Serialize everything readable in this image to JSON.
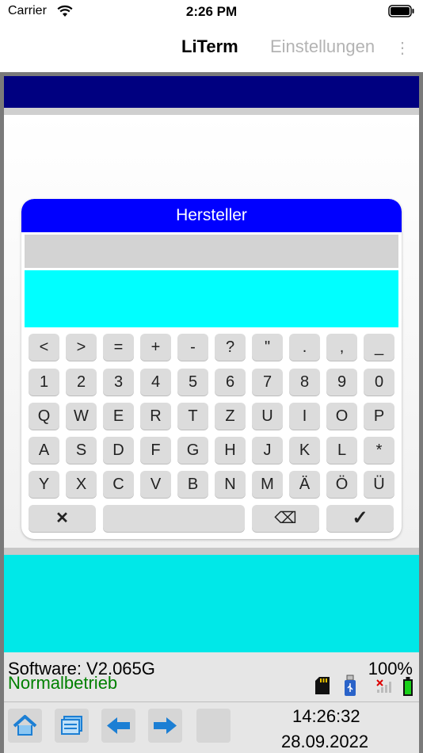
{
  "status_bar": {
    "carrier": "Carrier",
    "time": "2:26 PM"
  },
  "nav": {
    "title": "LiTerm",
    "settings": "Einstellungen",
    "more": "⋮"
  },
  "dialog": {
    "title": "Hersteller",
    "keys_row1": [
      "<",
      ">",
      "=",
      "+",
      "-",
      "?",
      "\"",
      ".",
      ",",
      "_"
    ],
    "keys_row2": [
      "1",
      "2",
      "3",
      "4",
      "5",
      "6",
      "7",
      "8",
      "9",
      "0"
    ],
    "keys_row3": [
      "Q",
      "W",
      "E",
      "R",
      "T",
      "Z",
      "U",
      "I",
      "O",
      "P"
    ],
    "keys_row4": [
      "A",
      "S",
      "D",
      "F",
      "G",
      "H",
      "J",
      "K",
      "L",
      "*"
    ],
    "keys_row5": [
      "Y",
      "X",
      "C",
      "V",
      "B",
      "N",
      "M",
      "Ä",
      "Ö",
      "Ü"
    ],
    "cancel_key": "✕",
    "backspace_key": "⌫",
    "confirm_key": "✓"
  },
  "status": {
    "software": "Software: V2.065G",
    "mode": "Normalbetrieb",
    "battery_percent": "100%"
  },
  "toolbar": {
    "time": "14:26:32",
    "date": "28.09.2022"
  },
  "colors": {
    "title_bar": "#000080",
    "dialog_header": "#0000ff",
    "cyan": "#00ffff",
    "mode_text": "#008000"
  }
}
